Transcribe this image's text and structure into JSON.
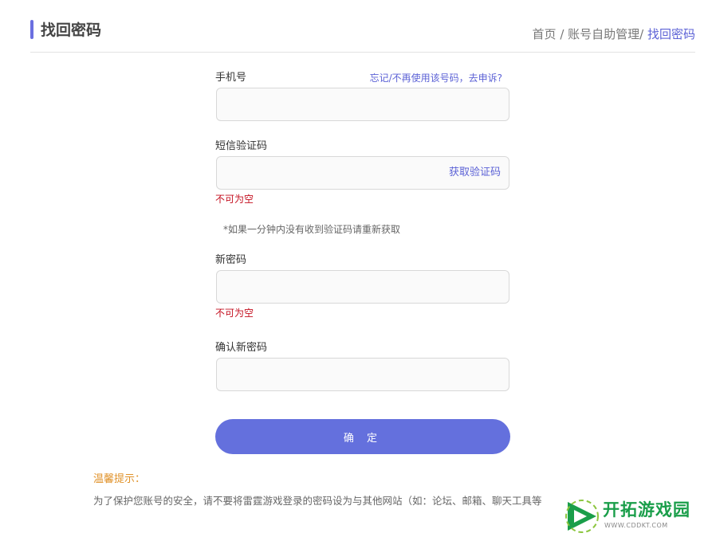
{
  "header": {
    "title": "找回密码",
    "breadcrumb": {
      "home": "首页",
      "sep1": " / ",
      "section": "账号自助管理",
      "sep2": "/ ",
      "current": "找回密码"
    }
  },
  "form": {
    "phone": {
      "label": "手机号",
      "link": "忘记/不再使用该号码，去申诉?",
      "value": ""
    },
    "sms": {
      "label": "短信验证码",
      "value": "",
      "get_code": "获取验证码",
      "error": "不可为空",
      "hint": "*如果一分钟内没有收到验证码请重新获取"
    },
    "new_password": {
      "label": "新密码",
      "value": "",
      "error": "不可为空"
    },
    "confirm_password": {
      "label": "确认新密码",
      "value": ""
    },
    "submit_label": "确 定"
  },
  "tips": {
    "title": "温馨提示：",
    "text": "为了保护您账号的安全，请不要将雷霆游戏登录的密码设为与其他网站（如：论坛、邮箱、聊天工具等"
  },
  "watermark": {
    "name": "开拓游戏园",
    "url": "WWW.CDDKT.COM",
    "color": "#1a9e4a"
  },
  "colors": {
    "accent": "#6470dd",
    "link": "#5c62d6",
    "error": "#c40f1f",
    "tips_title": "#e0922a"
  }
}
